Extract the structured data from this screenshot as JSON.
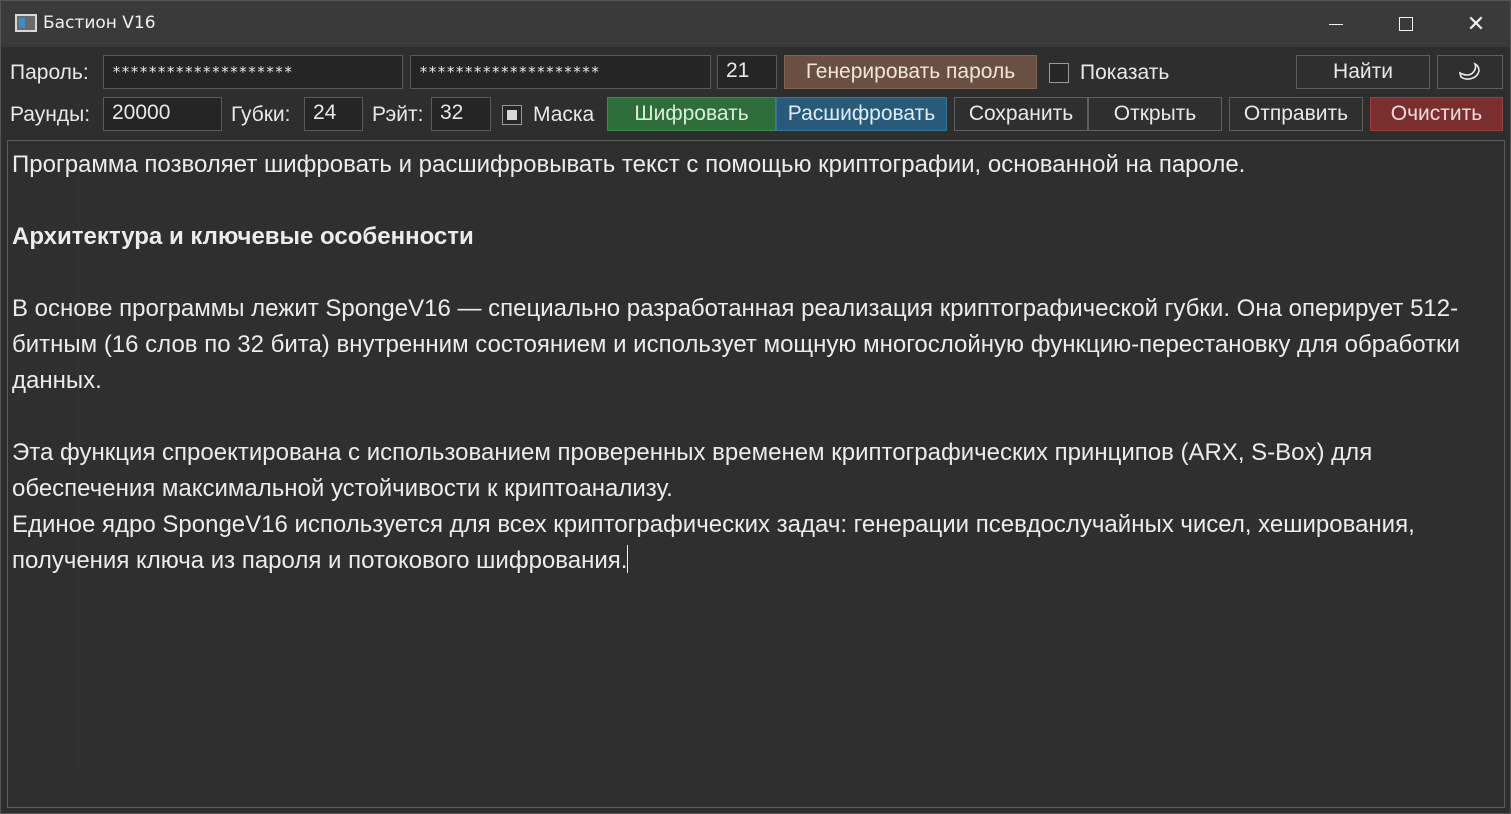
{
  "window": {
    "title": "Бастион V16",
    "minimize_icon": "minimize-icon",
    "maximize_icon": "maximize-icon",
    "close_icon": "close-icon"
  },
  "toolbar_row1": {
    "password_label": "Пароль:",
    "password_value": "********************",
    "password_confirm_value": "********************",
    "password_length": "21",
    "generate_label": "Генерировать пароль",
    "show_label": "Показать",
    "show_checked": false,
    "find_label": "Найти",
    "theme_icon": "moon-icon"
  },
  "toolbar_row2": {
    "rounds_label": "Раунды:",
    "rounds_value": "20000",
    "sponges_label": "Губки:",
    "sponges_value": "24",
    "rate_label": "Рэйт:",
    "rate_value": "32",
    "mask_label": "Маска",
    "mask_checked": true,
    "encrypt_label": "Шифровать",
    "decrypt_label": "Расшифровать",
    "save_label": "Сохранить",
    "open_label": "Открыть",
    "send_label": "Отправить",
    "clear_label": "Очистить"
  },
  "colors": {
    "generate": "#6a4f43",
    "encrypt": "#2f6e3a",
    "decrypt": "#2a5a7a",
    "clear": "#7a2e2e"
  },
  "editor": {
    "p1": "Программа позволяет шифровать и расшифровывать текст с помощью криптографии, основанной на пароле.",
    "heading": "Архитектура и ключевые особенности",
    "p2": "В основе программы лежит SpongeV16 — специально разработанная реализация криптографической губки. Она оперирует 512-битным (16 слов по 32 бита) внутренним состоянием и использует мощную многослойную функцию-перестановку для обработки данных.",
    "p3a": "Эта функция спроектирована с использованием проверенных временем криптографических принципов (ARX, S-Box) для обеспечения максимальной устойчивости к криптоанализу.",
    "p3b": "Единое ядро SpongeV16 используется для всех криптографических задач: генерации псевдослучайных чисел, хеширования, получения ключа из пароля и потокового шифрования."
  }
}
